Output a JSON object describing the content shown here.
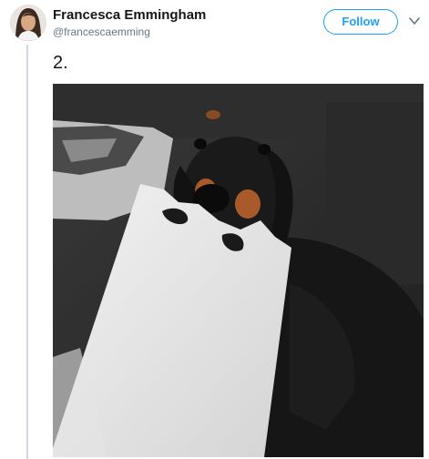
{
  "author": {
    "name": "Francesca Emmingham",
    "handle": "@francescaemming",
    "avatar_icon": "profile-photo"
  },
  "actions": {
    "follow_label": "Follow",
    "menu_icon": "chevron-down-icon"
  },
  "tweet": {
    "text": "2."
  },
  "colors": {
    "accent": "#1da1f2",
    "name": "#14171a",
    "handle": "#657786",
    "thread_line": "#cfd9e4"
  }
}
